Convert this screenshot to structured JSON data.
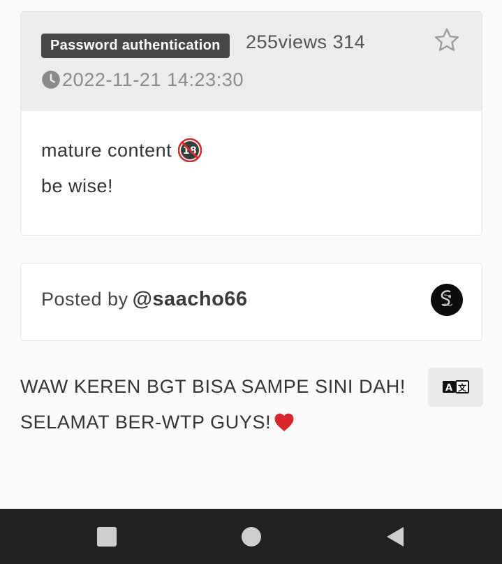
{
  "post": {
    "badge": "Password authentication",
    "views": "255views 314",
    "timestamp": "2022-11-21 14:23:30",
    "body_lines": [
      "mature content",
      "be wise!"
    ],
    "body_emoji": "18",
    "icons": {
      "favorite": "star-outline-icon",
      "time": "clock-icon",
      "mature": "no-under-18-icon"
    }
  },
  "author": {
    "prefix": "Posted by",
    "handle": "@saacho66"
  },
  "comment": {
    "lines": [
      "WAW KEREN BGT BISA SAMPE SINI DAH!",
      "SELAMAT BER-WTP GUYS!"
    ],
    "translate_icon": "translate-icon"
  },
  "navbar": {
    "buttons": [
      "recents-icon",
      "home-icon",
      "back-icon"
    ],
    "color": "#222222"
  },
  "colors": {
    "badge_bg": "#474747",
    "header_bg": "#ececec",
    "heart": "#d7262c"
  }
}
